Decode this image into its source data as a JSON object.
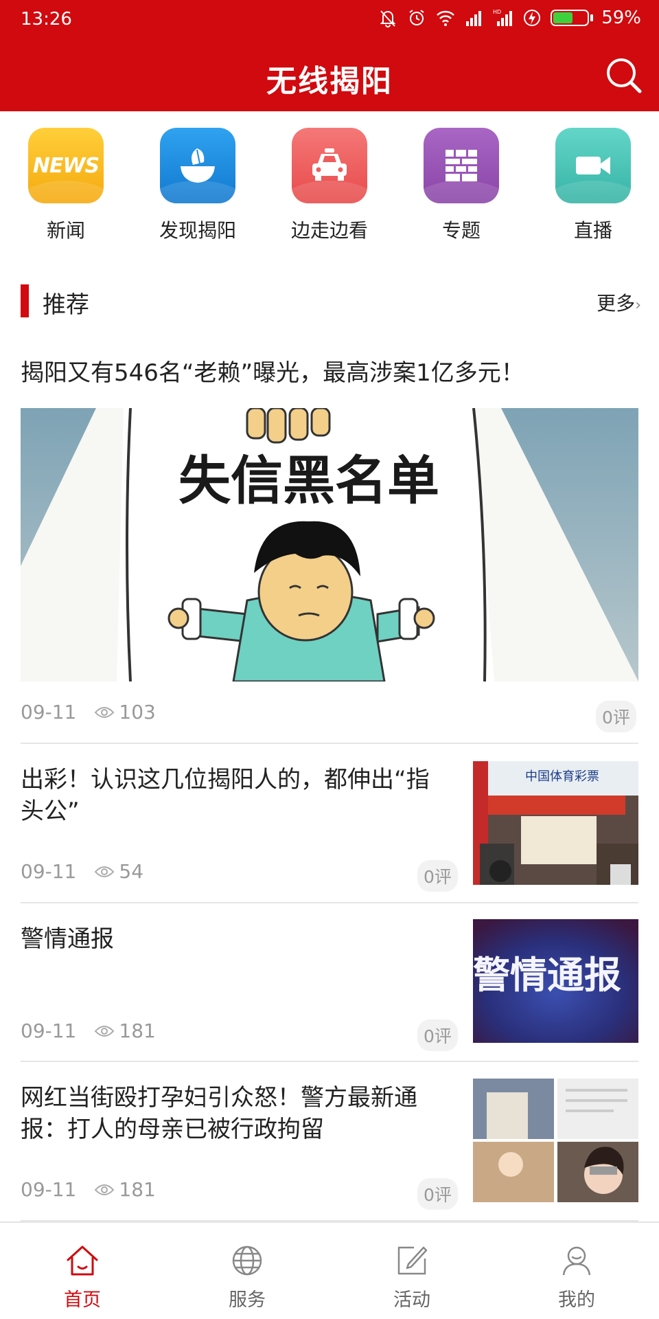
{
  "status_bar": {
    "time": "13:26",
    "battery_text": "59%",
    "battery_level": 0.59
  },
  "header": {
    "title": "无线揭阳"
  },
  "quick_nav": [
    {
      "label": "新闻",
      "icon": "news-icon",
      "icon_text": "NEWS",
      "color": "#f6b91a"
    },
    {
      "label": "发现揭阳",
      "icon": "discover-icon",
      "color": "#1d8fe0"
    },
    {
      "label": "边走边看",
      "icon": "car-icon",
      "color": "#ee5d5d"
    },
    {
      "label": "专题",
      "icon": "topic-icon",
      "color": "#9b56b8"
    },
    {
      "label": "直播",
      "icon": "live-video-icon",
      "color": "#4cc6b8"
    }
  ],
  "section": {
    "title": "推荐",
    "more": "更多"
  },
  "featured": {
    "title": "揭阳又有546名“老赖”曝光，最高涉案1亿多元！",
    "image_text": "失信黑名单",
    "date": "09-11",
    "views": "103",
    "comments": "0评"
  },
  "articles": [
    {
      "title": "出彩！认识这几位揭阳人的，都伸出“指头公”",
      "date": "09-11",
      "views": "54",
      "comments": "0评",
      "thumb_text": "中国体育彩票"
    },
    {
      "title": "警情通报",
      "date": "09-11",
      "views": "181",
      "comments": "0评",
      "thumb_text": "警情通报"
    },
    {
      "title": "网红当街殴打孕妇引众怒！警方最新通报：打人的母亲已被行政拘留",
      "date": "09-11",
      "views": "181",
      "comments": "0评"
    }
  ],
  "tabs": [
    {
      "label": "首页",
      "icon": "home-icon",
      "active": true
    },
    {
      "label": "服务",
      "icon": "globe-icon",
      "active": false
    },
    {
      "label": "活动",
      "icon": "edit-icon",
      "active": false
    },
    {
      "label": "我的",
      "icon": "user-icon",
      "active": false
    }
  ],
  "colors": {
    "brand": "#d00a0e",
    "meta_text": "#999999"
  }
}
